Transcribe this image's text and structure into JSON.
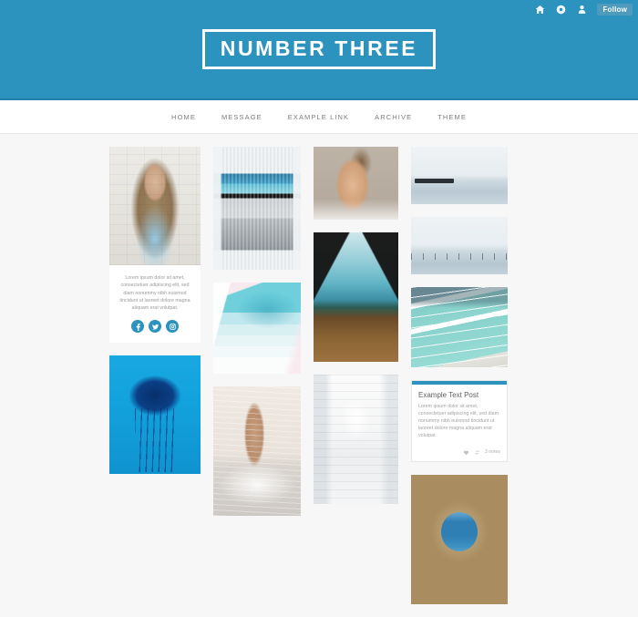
{
  "tumblr_bar": {
    "icons": [
      {
        "name": "home-icon",
        "label": "Home"
      },
      {
        "name": "dashboard-icon",
        "label": "Dashboard"
      },
      {
        "name": "account-icon",
        "label": "Account"
      }
    ],
    "follow_label": "Follow",
    "button_color": "#4e9bbd"
  },
  "header": {
    "title": "NUMBER THREE",
    "background_color": "#2b93bd",
    "title_border_color": "#ffffff"
  },
  "nav": {
    "items": [
      {
        "label": "HOME",
        "name": "nav-item-home"
      },
      {
        "label": "MESSAGE",
        "name": "nav-item-message"
      },
      {
        "label": "EXAMPLE LINK",
        "name": "nav-item-example-link"
      },
      {
        "label": "ARCHIVE",
        "name": "nav-item-archive"
      },
      {
        "label": "THEME",
        "name": "nav-item-theme"
      }
    ],
    "text_color": "#7d7d7d",
    "background_color": "#ffffff"
  },
  "posts": {
    "column_1": {
      "photo_portrait": {
        "name": "post-photo-portrait",
        "alt": "Blonde woman in light blue tank top against white brick wall"
      },
      "text_post": {
        "name": "post-text-social",
        "body": "Lorem ipsum dolor sit amet, consectetuer adipiscing elit, sed diam nonummy nibh euismod tincidunt ut laoreet dolore magna aliquam erat volutpat.",
        "social": [
          {
            "name": "facebook-icon",
            "label": "Facebook"
          },
          {
            "name": "twitter-icon",
            "label": "Twitter"
          },
          {
            "name": "instagram-icon",
            "label": "Instagram"
          }
        ],
        "social_color": "#2b93bd"
      },
      "photo_jellyfish": {
        "name": "post-photo-jellyfish",
        "alt": "Dark blue jellyfish on bright cyan water background"
      }
    },
    "column_2": {
      "photo_collage": {
        "name": "post-photo-beach-collage",
        "alt": "Surreal collage of ocean waves merging into a bedroom"
      },
      "photo_pool_steps": {
        "name": "post-photo-pool-steps",
        "alt": "Pastel turquoise swimming pool steps"
      },
      "photo_splash": {
        "name": "post-photo-splash",
        "alt": "Woman in white bikini splashing in the sea"
      }
    },
    "column_3": {
      "photo_smiling": {
        "name": "post-photo-smiling-woman",
        "alt": "Smiling woman looking down on a warm taupe background"
      },
      "photo_glass_pool": {
        "name": "post-photo-glass-pool",
        "alt": "Wooden corridor beneath a glass bottom swimming pool"
      },
      "photo_white_stairs": {
        "name": "post-photo-white-stairs",
        "alt": "White washed Greek village alley with stairs"
      }
    },
    "column_4": {
      "photo_sea_top": {
        "name": "post-photo-seascape-one",
        "alt": "Pale seascape with a distant jetty"
      },
      "photo_sea_bottom": {
        "name": "post-photo-seascape-two",
        "alt": "Pale seascape with people wading in shallow water"
      },
      "photo_icebergs": {
        "name": "post-photo-icebergs-pool",
        "alt": "Ocean side lap pool with turquoise water"
      },
      "example_text_post": {
        "name": "post-example-text",
        "title": "Example Text Post",
        "body": "Lorem ipsum dolor sit amet, consectetuer adipiscing elit, sed diam nonummy nibh euismod tincidunt ut laoreet dolore magna aliquam erat volutpat.",
        "notes": "3 notes",
        "accent_color": "#2b93bd",
        "actions": [
          {
            "name": "like-heart-icon",
            "label": "Like"
          },
          {
            "name": "reblog-icon",
            "label": "Reblog"
          }
        ]
      },
      "photo_arch": {
        "name": "post-photo-azure-window",
        "alt": "Azure Window natural rock arch over the sea"
      }
    }
  }
}
